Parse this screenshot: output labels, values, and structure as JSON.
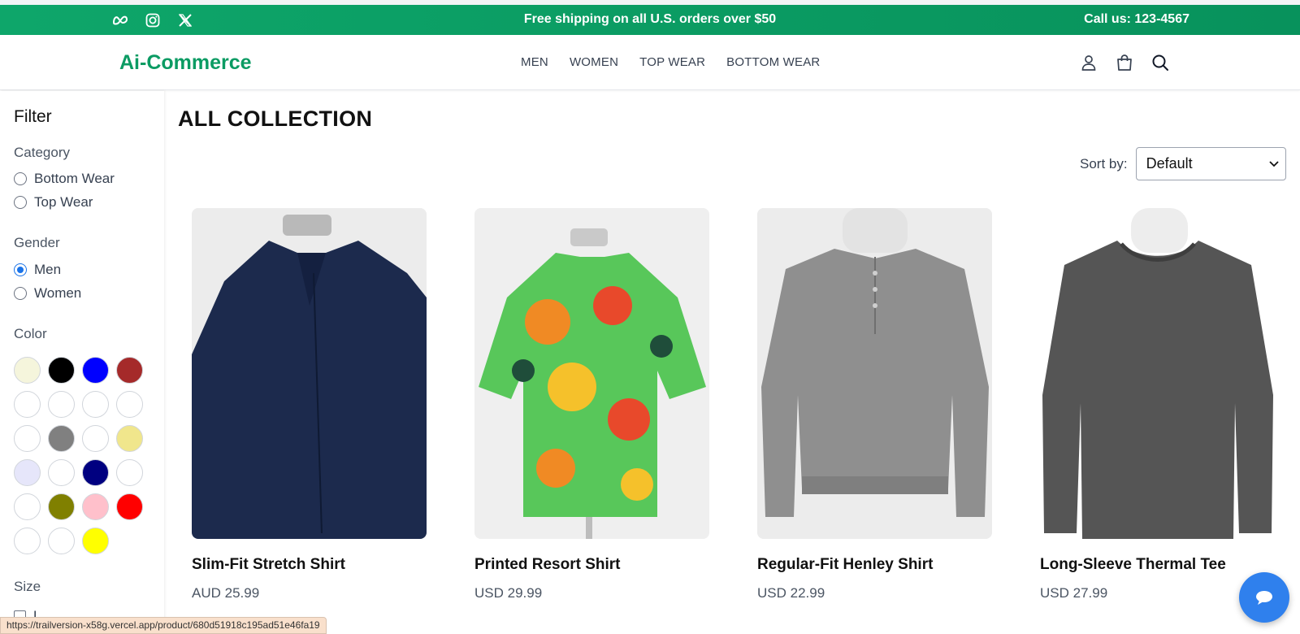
{
  "topbar": {
    "promo": "Free shipping on all U.S. orders over $50",
    "phone": "Call us: 123-4567",
    "social_icons": [
      "meta-icon",
      "instagram-icon",
      "x-icon"
    ],
    "background": "#0ea66a"
  },
  "header": {
    "logo": "Ai-Commerce",
    "nav": [
      "MEN",
      "WOMEN",
      "TOP WEAR",
      "BOTTOM WEAR"
    ],
    "icons": [
      "user-icon",
      "shopping-bag-icon",
      "search-icon"
    ]
  },
  "filter": {
    "title": "Filter",
    "category": {
      "label": "Category",
      "options": [
        "Bottom Wear",
        "Top Wear"
      ],
      "selected": null
    },
    "gender": {
      "label": "Gender",
      "options": [
        "Men",
        "Women"
      ],
      "selected": "Men"
    },
    "color": {
      "label": "Color",
      "swatches": [
        "#f5f5dc",
        "#000000",
        "#0000ff",
        "#a52a2a",
        "#ffffff",
        "#ffffff",
        "#ffffff",
        "#ffffff",
        "#ffffff",
        "#808080",
        "#ffffff",
        "#f0e68c",
        "#e6e6fa",
        "#ffffff",
        "#000080",
        "#ffffff",
        "#ffffff",
        "#808000",
        "#ffc0cb",
        "#ff0000",
        "#ffffff",
        "#ffffff",
        "#ffff00"
      ]
    },
    "size": {
      "label": "Size",
      "first_option": "L"
    }
  },
  "main": {
    "title": "ALL COLLECTION",
    "sort_label": "Sort by:",
    "sort_value": "Default"
  },
  "products": [
    {
      "name": "Slim-Fit Stretch Shirt",
      "price": "AUD 25.99",
      "color": "#1c2a4d"
    },
    {
      "name": "Printed Resort Shirt",
      "price": "USD 29.99",
      "color": "#58c75a"
    },
    {
      "name": "Regular-Fit Henley Shirt",
      "price": "USD 22.99",
      "color": "#8f8f8f"
    },
    {
      "name": "Long-Sleeve Thermal Tee",
      "price": "USD 27.99",
      "color": "#555555"
    }
  ],
  "status_url": "https://trailversion-x58g.vercel.app/product/680d51918c195ad51e46fa19",
  "accent": "#0b9b63"
}
